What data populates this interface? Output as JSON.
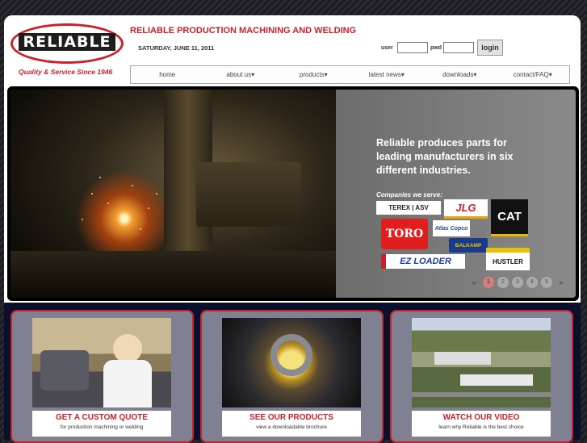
{
  "brand": {
    "name": "RELIABLE",
    "tagline": "Quality & Service Since 1946"
  },
  "header": {
    "site_title": "RELIABLE PRODUCTION MACHINING AND WELDING",
    "date": "SATURDAY, JUNE 11, 2011",
    "user_label": "user",
    "pwd_label": "pwd",
    "login_label": "login"
  },
  "nav": [
    {
      "label": "home"
    },
    {
      "label": "about us▾"
    },
    {
      "label": "products▾"
    },
    {
      "label": "latest news▾"
    },
    {
      "label": "downloads▾"
    },
    {
      "label": "contact/FAQ▾"
    }
  ],
  "hero": {
    "headline": "Reliable produces parts for leading manufacturers in six different industries.",
    "companies_label": "Companies we serve:",
    "companies": [
      "TEREX | ASV",
      "JLG",
      "CAT",
      "TORO",
      "Atlas Copco",
      "BALKAMP",
      "EZ LOADER",
      "HUSTLER"
    ],
    "pager": {
      "prev": "«",
      "next": "»",
      "pages": [
        "1",
        "2",
        "3",
        "4",
        "5"
      ],
      "active": "1"
    }
  },
  "cards": [
    {
      "title": "GET A CUSTOM QUOTE",
      "subtitle": "for production machining or welding"
    },
    {
      "title": "SEE OUR PRODUCTS",
      "subtitle": "view a downloadable brochure"
    },
    {
      "title": "WATCH OUR VIDEO",
      "subtitle": "learn why Reliable is the best choice"
    }
  ],
  "colors": {
    "accent": "#c8232c",
    "footer": "#0a0f2c",
    "panel": "#7c7c7c"
  }
}
